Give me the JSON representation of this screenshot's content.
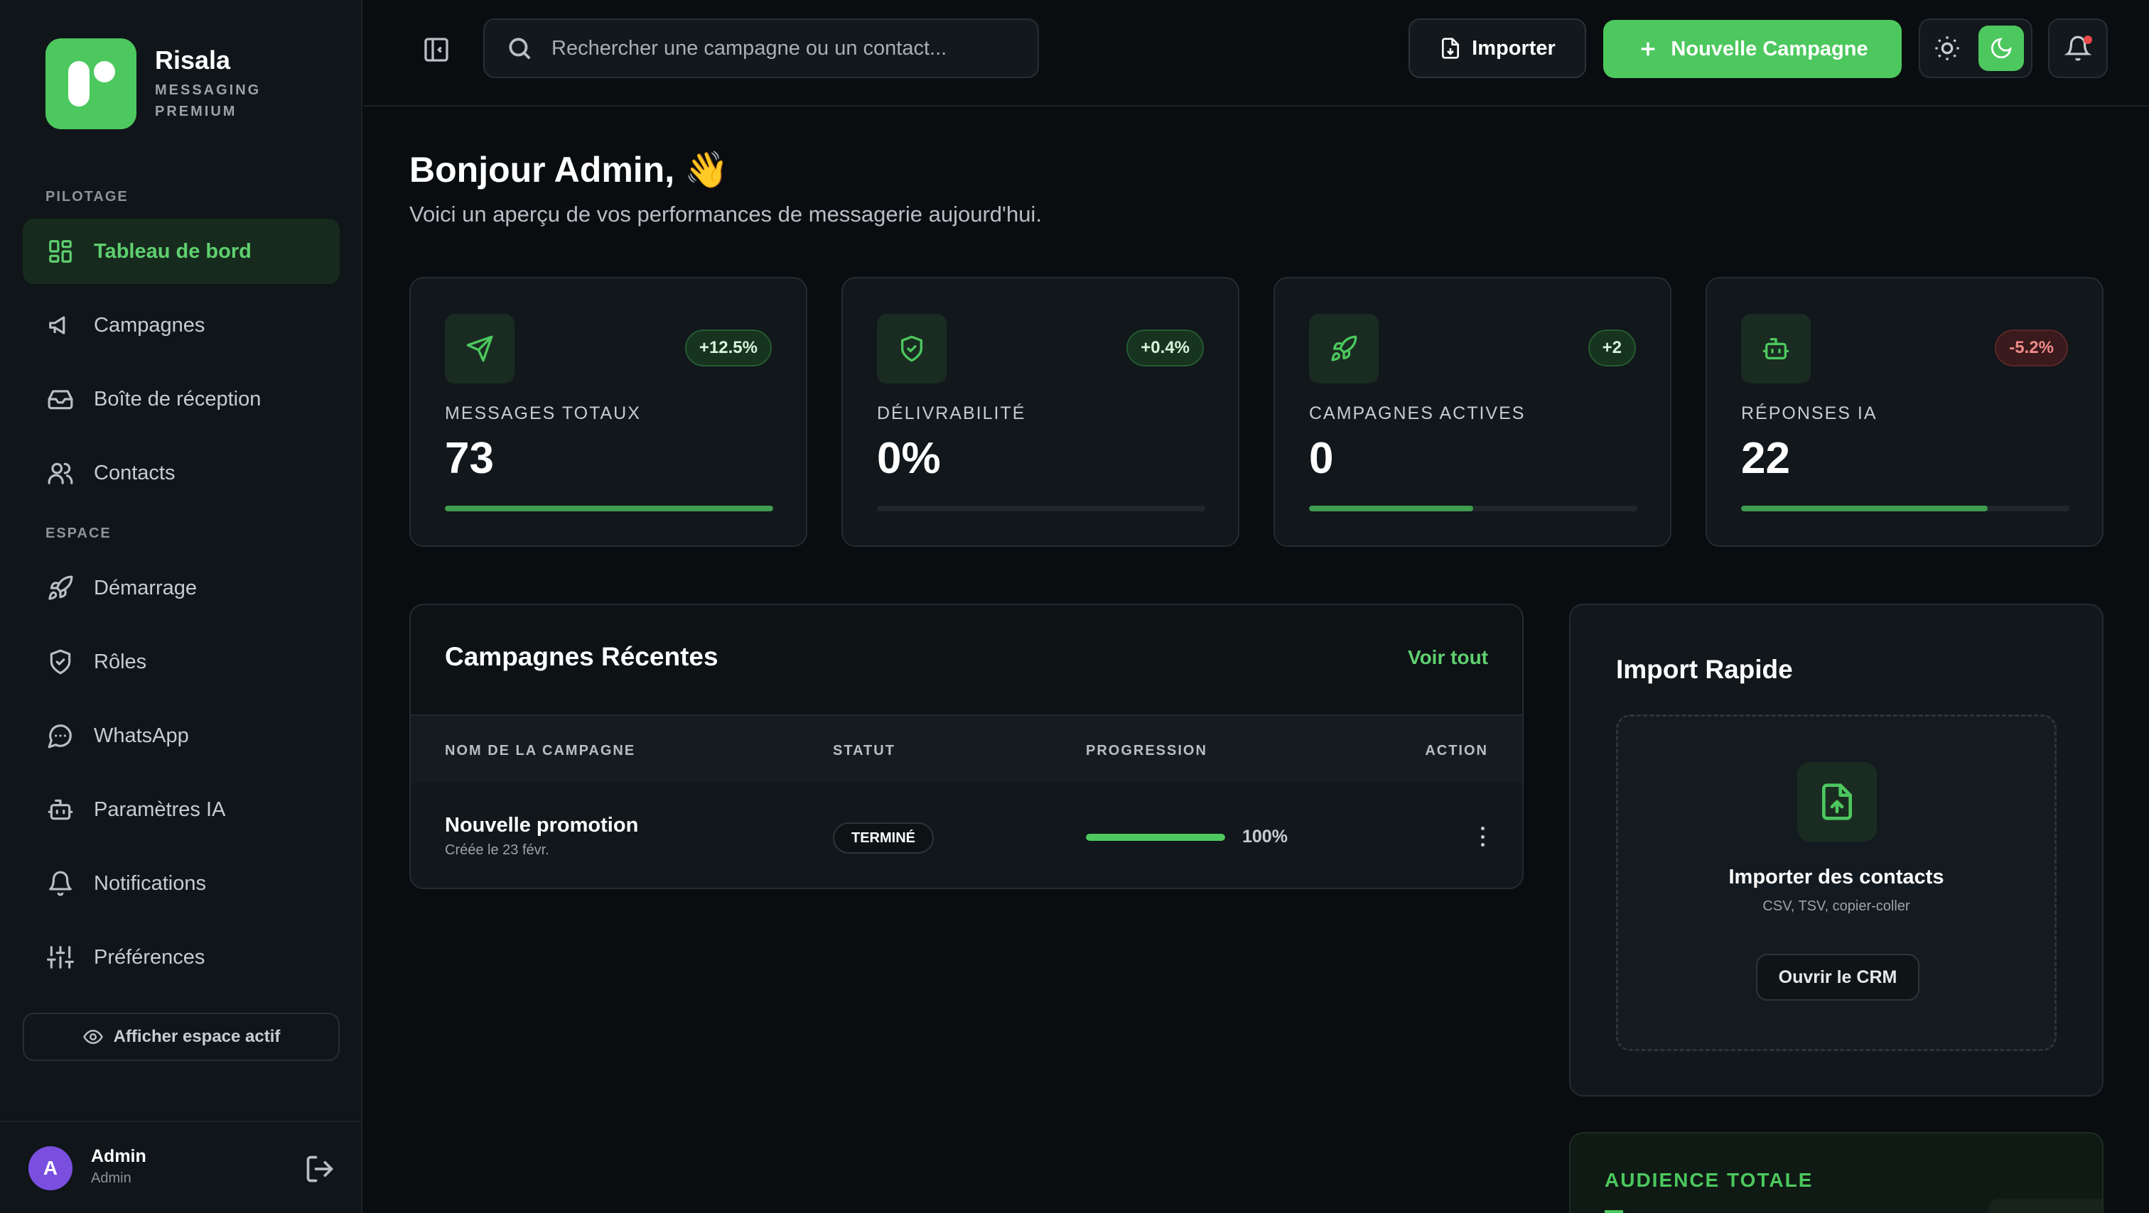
{
  "brand": {
    "name": "Risala",
    "subtitle": "MESSAGING PREMIUM"
  },
  "sidebar": {
    "sections": [
      {
        "title": "PILOTAGE"
      },
      {
        "title": "ESPACE"
      }
    ],
    "items": [
      {
        "label": "Tableau de bord",
        "icon": "dashboard-icon",
        "active": true
      },
      {
        "label": "Campagnes",
        "icon": "megaphone-icon"
      },
      {
        "label": "Boîte de réception",
        "icon": "inbox-icon"
      },
      {
        "label": "Contacts",
        "icon": "users-icon"
      },
      {
        "label": "Démarrage",
        "icon": "rocket-icon"
      },
      {
        "label": "Rôles",
        "icon": "shield-icon"
      },
      {
        "label": "WhatsApp",
        "icon": "chat-bubble-icon"
      },
      {
        "label": "Paramètres IA",
        "icon": "bot-icon"
      },
      {
        "label": "Notifications",
        "icon": "bell-icon"
      },
      {
        "label": "Préférences",
        "icon": "sliders-icon"
      }
    ],
    "show_space_label": "Afficher espace actif",
    "user": {
      "initial": "A",
      "name": "Admin",
      "role": "Admin"
    }
  },
  "header": {
    "search_placeholder": "Rechercher une campagne ou un contact...",
    "import_label": "Importer",
    "new_campaign_label": "Nouvelle Campagne"
  },
  "main": {
    "greeting": "Bonjour Admin, 👋",
    "subtitle": "Voici un aperçu de vos performances de messagerie aujourd'hui.",
    "stats": [
      {
        "label": "MESSAGES TOTAUX",
        "value": "73",
        "delta": "+12.5%",
        "trend": "up",
        "progress": 1.0,
        "icon": "send-icon"
      },
      {
        "label": "DÉLIVRABILITÉ",
        "value": "0%",
        "delta": "+0.4%",
        "trend": "up",
        "progress": 0.0,
        "icon": "shield-check-icon"
      },
      {
        "label": "CAMPAGNES ACTIVES",
        "value": "0",
        "delta": "+2",
        "trend": "up",
        "progress": 0.5,
        "icon": "rocket-icon"
      },
      {
        "label": "RÉPONSES IA",
        "value": "22",
        "delta": "-5.2%",
        "trend": "down",
        "progress": 0.75,
        "icon": "bot-icon"
      }
    ],
    "recent": {
      "title": "Campagnes Récentes",
      "see_all": "Voir tout",
      "columns": [
        "NOM DE LA CAMPAGNE",
        "STATUT",
        "PROGRESSION",
        "ACTION"
      ],
      "rows": [
        {
          "name": "Nouvelle promotion",
          "created": "Créée le 23 févr.",
          "status": "TERMINÉ",
          "progress": 1.0,
          "progress_text": "100%"
        }
      ]
    },
    "quick_import": {
      "title": "Import Rapide",
      "drop_title": "Importer des contacts",
      "drop_sub": "CSV, TSV, copier-coller",
      "button": "Ouvrir le CRM"
    },
    "audience": {
      "label": "AUDIENCE TOTALE"
    }
  },
  "colors": {
    "accent": "#4cc85e",
    "danger": "#f08a8a",
    "background": "#0a0d10"
  }
}
